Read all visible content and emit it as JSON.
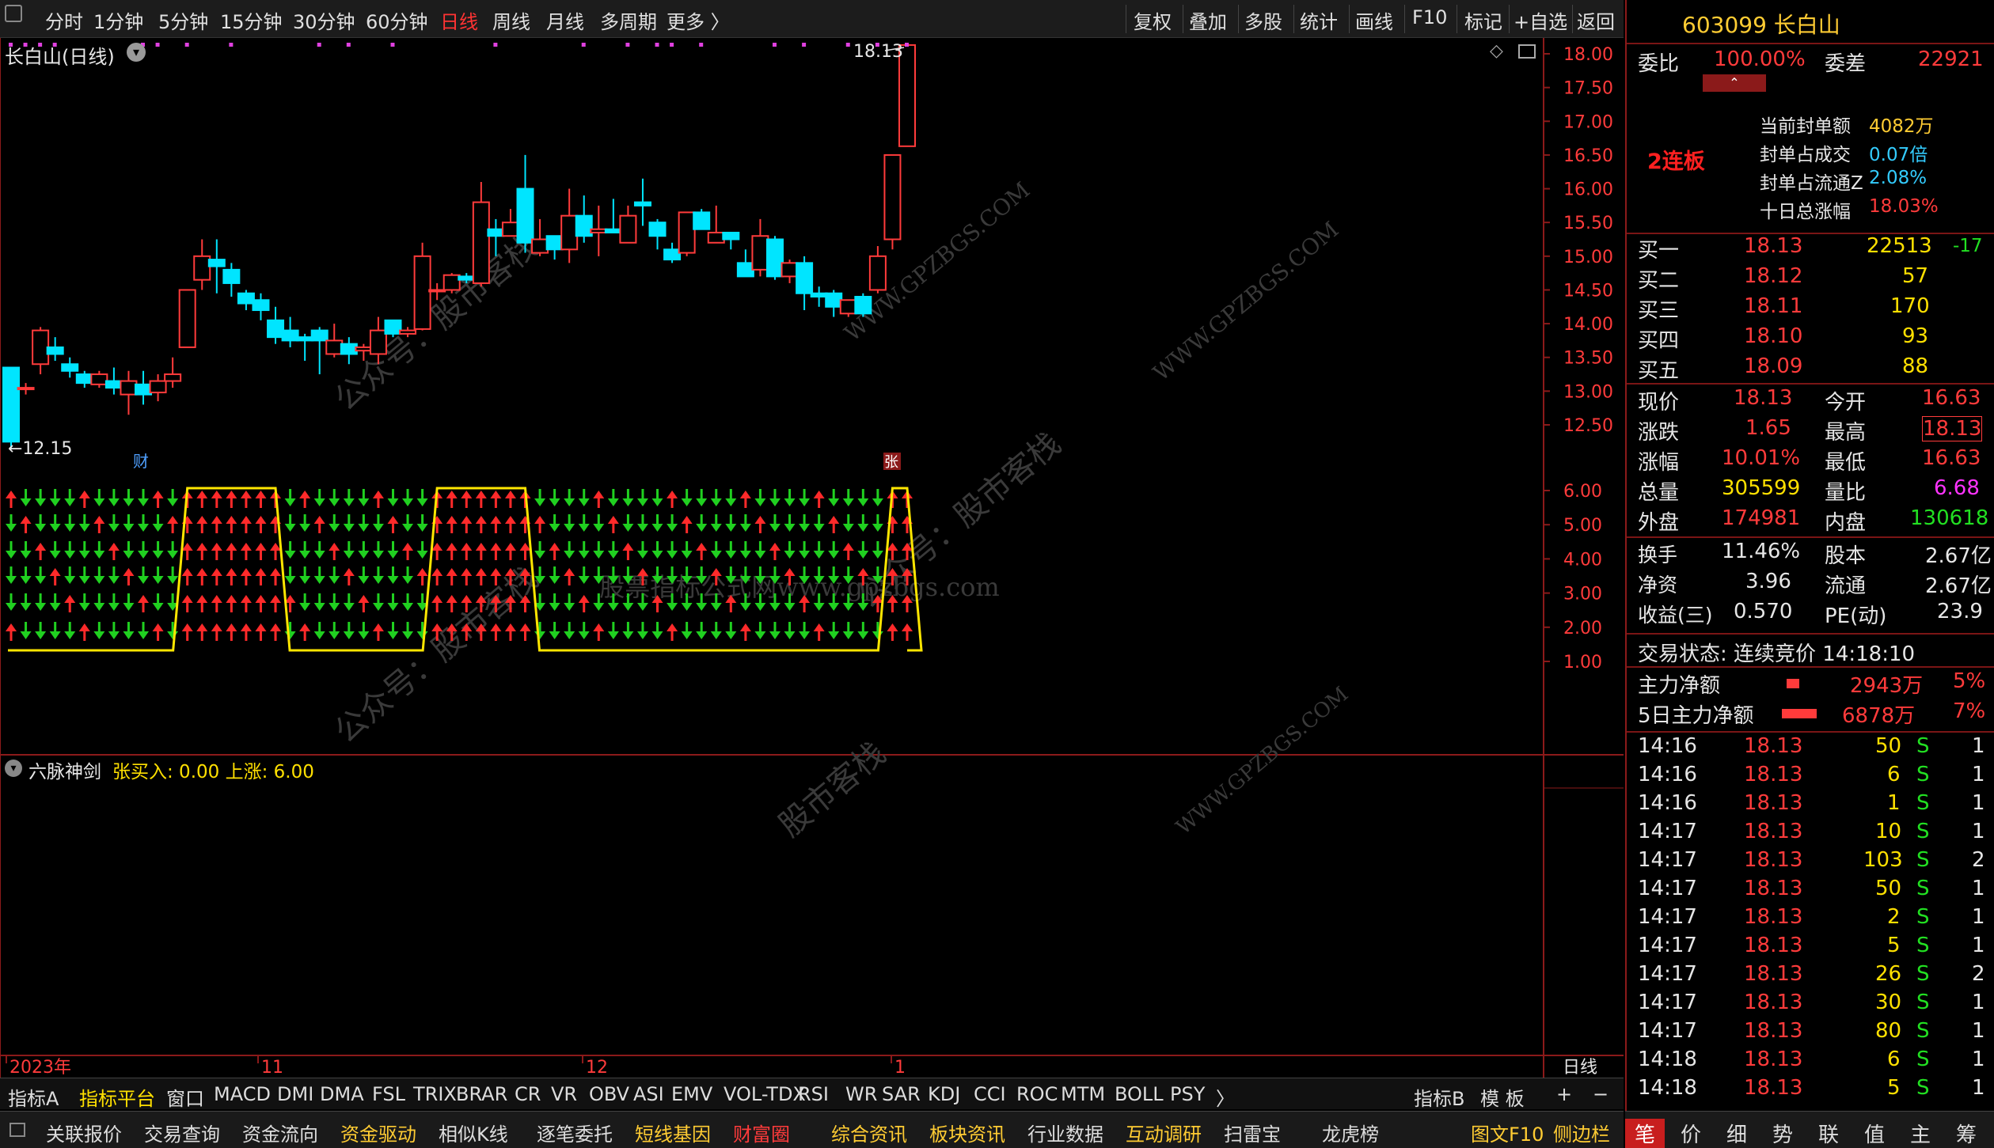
{
  "topbar": {
    "items": [
      "分时",
      "1分钟",
      "5分钟",
      "15分钟",
      "30分钟",
      "60分钟",
      "日线",
      "周线",
      "月线",
      "多周期",
      "更多 〉"
    ],
    "active": "日线",
    "right": [
      "复权",
      "叠加",
      "多股",
      "统计",
      "画线",
      "F10",
      "标记",
      "+自选",
      "返回"
    ]
  },
  "kchart": {
    "title": "长白山(日线)",
    "last_label": "18.13",
    "low_label": "12.15",
    "fin_mark": "财",
    "zhang_mark": "张",
    "yticks": [
      "18.00",
      "17.50",
      "17.00",
      "16.50",
      "16.00",
      "15.50",
      "15.00",
      "14.50",
      "14.00",
      "13.50",
      "13.00",
      "12.50"
    ],
    "watermarks": [
      "公众号：股市客栈",
      "WWW.GPZBGS.COM",
      "股票指标公式网www.gpzbgs.com",
      "公众号：股市客栈",
      "WWW.GPZBGS.COM",
      "公众号：股市客栈",
      "股市客栈",
      "WWW.GPZBGS.COM"
    ]
  },
  "chart_data": {
    "type": "candlestick",
    "title": "长白山(日线)",
    "candles": [
      [
        13.35,
        12.25,
        13.35,
        12.15
      ],
      [
        13.05,
        13.05,
        13.12,
        12.95
      ],
      [
        13.4,
        13.9,
        13.95,
        13.25
      ],
      [
        13.65,
        13.55,
        13.8,
        13.45
      ],
      [
        13.4,
        13.3,
        13.5,
        13.2
      ],
      [
        13.25,
        13.12,
        13.3,
        13.05
      ],
      [
        13.1,
        13.25,
        13.3,
        13.05
      ],
      [
        13.15,
        13.05,
        13.35,
        12.95
      ],
      [
        12.95,
        13.15,
        13.3,
        12.65
      ],
      [
        13.1,
        12.95,
        13.3,
        12.8
      ],
      [
        12.98,
        13.15,
        13.25,
        12.85
      ],
      [
        13.15,
        13.25,
        13.5,
        13.05
      ],
      [
        13.65,
        14.5,
        14.5,
        13.65
      ],
      [
        14.65,
        15.0,
        15.25,
        14.5
      ],
      [
        14.95,
        14.85,
        15.25,
        14.45
      ],
      [
        14.8,
        14.6,
        14.9,
        14.4
      ],
      [
        14.45,
        14.3,
        14.5,
        14.2
      ],
      [
        14.35,
        14.2,
        14.45,
        14.05
      ],
      [
        14.05,
        13.8,
        14.25,
        13.7
      ],
      [
        13.9,
        13.75,
        14.1,
        13.65
      ],
      [
        13.8,
        13.75,
        13.85,
        13.45
      ],
      [
        13.9,
        13.75,
        13.95,
        13.25
      ],
      [
        13.55,
        13.75,
        14.0,
        13.5
      ],
      [
        13.7,
        13.55,
        13.8,
        13.4
      ],
      [
        13.6,
        13.65,
        13.7,
        13.45
      ],
      [
        13.55,
        13.9,
        14.1,
        13.4
      ],
      [
        14.05,
        13.85,
        14.05,
        13.8
      ],
      [
        13.85,
        13.9,
        13.95,
        13.8
      ],
      [
        13.92,
        15.0,
        15.2,
        13.9
      ],
      [
        14.5,
        14.5,
        14.6,
        14.35
      ],
      [
        14.5,
        14.72,
        14.75,
        14.45
      ],
      [
        14.7,
        14.65,
        14.75,
        14.6
      ],
      [
        14.6,
        15.8,
        16.1,
        14.55
      ],
      [
        15.4,
        15.3,
        15.55,
        15.0
      ],
      [
        15.3,
        15.5,
        15.7,
        15.3
      ],
      [
        16.0,
        15.2,
        16.5,
        15.05
      ],
      [
        15.05,
        15.25,
        15.55,
        15.0
      ],
      [
        15.3,
        15.1,
        15.25,
        14.95
      ],
      [
        15.1,
        15.6,
        16.0,
        14.9
      ],
      [
        15.6,
        15.3,
        15.9,
        15.2
      ],
      [
        15.35,
        15.4,
        15.75,
        15.0
      ],
      [
        15.4,
        15.35,
        15.85,
        15.35
      ],
      [
        15.2,
        15.6,
        15.75,
        15.25
      ],
      [
        15.8,
        15.75,
        16.15,
        15.45
      ],
      [
        15.5,
        15.3,
        15.55,
        15.1
      ],
      [
        15.1,
        14.95,
        15.2,
        14.9
      ],
      [
        15.05,
        15.65,
        15.65,
        15.0
      ],
      [
        15.65,
        15.4,
        15.7,
        15.45
      ],
      [
        15.2,
        15.35,
        15.75,
        15.2
      ],
      [
        15.35,
        15.25,
        15.35,
        15.1
      ],
      [
        14.9,
        14.7,
        15.1,
        14.8
      ],
      [
        14.8,
        15.3,
        15.55,
        14.7
      ],
      [
        15.25,
        14.7,
        15.3,
        14.65
      ],
      [
        14.7,
        14.9,
        14.95,
        14.6
      ],
      [
        14.9,
        14.45,
        15.0,
        14.2
      ],
      [
        14.45,
        14.4,
        14.55,
        14.25
      ],
      [
        14.45,
        14.25,
        14.5,
        14.1
      ],
      [
        14.15,
        14.35,
        14.3,
        14.1
      ],
      [
        14.4,
        14.15,
        14.45,
        14.1
      ],
      [
        14.5,
        15.0,
        15.15,
        14.45
      ],
      [
        15.25,
        16.5,
        16.5,
        15.1
      ],
      [
        16.63,
        18.13,
        18.13,
        16.63
      ]
    ],
    "ylim": [
      12.15,
      18.15
    ],
    "indicator": {
      "title": "六脉神剑",
      "legend": "张买入: 0.00 上涨: 6.00",
      "yticks": [
        "6.00",
        "5.00",
        "4.00",
        "3.00",
        "2.00",
        "1.00"
      ],
      "signal_bands": [
        [
          12,
          18
        ],
        [
          29,
          35
        ],
        [
          60,
          61
        ]
      ]
    },
    "xlabels": [
      "2023年",
      "11",
      "12",
      "1"
    ],
    "xlabel_bottom": "日线"
  },
  "quote": {
    "code": "603099 长白山",
    "weibi_label": "委比",
    "weibi": "100.00%",
    "weicha_label": "委差",
    "weicha": "22921",
    "streak": "2连板",
    "seal": [
      {
        "label": "当前封单额",
        "value": "4082万"
      },
      {
        "label": "封单占成交",
        "value": "0.07倍"
      },
      {
        "label": "封单占流通Z",
        "value": "2.08%"
      },
      {
        "label": "十日总涨幅",
        "value": "18.03%"
      }
    ],
    "bids": [
      {
        "label": "买一",
        "price": "18.13",
        "vol": "22513",
        "chg": "-17"
      },
      {
        "label": "买二",
        "price": "18.12",
        "vol": "57",
        "chg": ""
      },
      {
        "label": "买三",
        "price": "18.11",
        "vol": "170",
        "chg": ""
      },
      {
        "label": "买四",
        "price": "18.10",
        "vol": "93",
        "chg": ""
      },
      {
        "label": "买五",
        "price": "18.09",
        "vol": "88",
        "chg": ""
      }
    ],
    "stats1": [
      [
        "现价",
        "18.13",
        "今开",
        "16.63"
      ],
      [
        "涨跌",
        "1.65",
        "最高",
        "18.13"
      ],
      [
        "涨幅",
        "10.01%",
        "最低",
        "16.63"
      ],
      [
        "总量",
        "305599",
        "量比",
        "6.68"
      ],
      [
        "外盘",
        "174981",
        "内盘",
        "130618"
      ]
    ],
    "stats2": [
      [
        "换手",
        "11.46%",
        "股本",
        "2.67亿"
      ],
      [
        "净资",
        "3.96",
        "流通",
        "2.67亿"
      ],
      [
        "收益(三)",
        "0.570",
        "PE(动)",
        "23.9"
      ]
    ],
    "status": "交易状态: 连续竞价 14:18:10",
    "flows": [
      {
        "label": "主力净额",
        "value": "2943万",
        "pct": "5%"
      },
      {
        "label": "5日主力净额",
        "value": "6878万",
        "pct": "7%"
      }
    ],
    "ticks": [
      [
        "14:16",
        "18.13",
        "50",
        "S",
        "1"
      ],
      [
        "14:16",
        "18.13",
        "6",
        "S",
        "1"
      ],
      [
        "14:16",
        "18.13",
        "1",
        "S",
        "1"
      ],
      [
        "14:17",
        "18.13",
        "10",
        "S",
        "1"
      ],
      [
        "14:17",
        "18.13",
        "103",
        "S",
        "2"
      ],
      [
        "14:17",
        "18.13",
        "50",
        "S",
        "1"
      ],
      [
        "14:17",
        "18.13",
        "2",
        "S",
        "1"
      ],
      [
        "14:17",
        "18.13",
        "5",
        "S",
        "1"
      ],
      [
        "14:17",
        "18.13",
        "26",
        "S",
        "2"
      ],
      [
        "14:17",
        "18.13",
        "30",
        "S",
        "1"
      ],
      [
        "14:17",
        "18.13",
        "80",
        "S",
        "1"
      ],
      [
        "14:18",
        "18.13",
        "6",
        "S",
        "1"
      ],
      [
        "14:18",
        "18.13",
        "5",
        "S",
        "1"
      ]
    ]
  },
  "tabs1": [
    "指标A",
    "指标平台",
    "窗口",
    "MACD",
    "DMI",
    "DMA",
    "FSL",
    "TRIX",
    "BRAR",
    "CR",
    "VR",
    "OBV",
    "ASI",
    "EMV",
    "VOL-TDX",
    "RSI",
    "WR",
    "SAR",
    "KDJ",
    "CCI",
    "ROC",
    "MTM",
    "BOLL",
    "PSY",
    "〉"
  ],
  "tabs1_right": [
    "指标B",
    "模 板",
    "+",
    "−"
  ],
  "tabs2": [
    "关联报价",
    "交易查询",
    "资金流向",
    "资金驱动",
    "相似K线",
    "逐笔委托",
    "短线基因",
    "财富圈",
    "综合资讯",
    "板块资讯",
    "行业数据",
    "互动调研",
    "扫雷宝",
    "龙虎榜"
  ],
  "tabs2_right": [
    "图文F10",
    "侧边栏"
  ],
  "rtabs": [
    "笔",
    "价",
    "细",
    "势",
    "联",
    "值",
    "主",
    "筹"
  ],
  "colors": {
    "up": "#ff3b3b",
    "down": "#00e5ff",
    "yellowline": "#ffe600",
    "arrowup": "#ff2a2a",
    "arrowdown": "#20d020"
  }
}
